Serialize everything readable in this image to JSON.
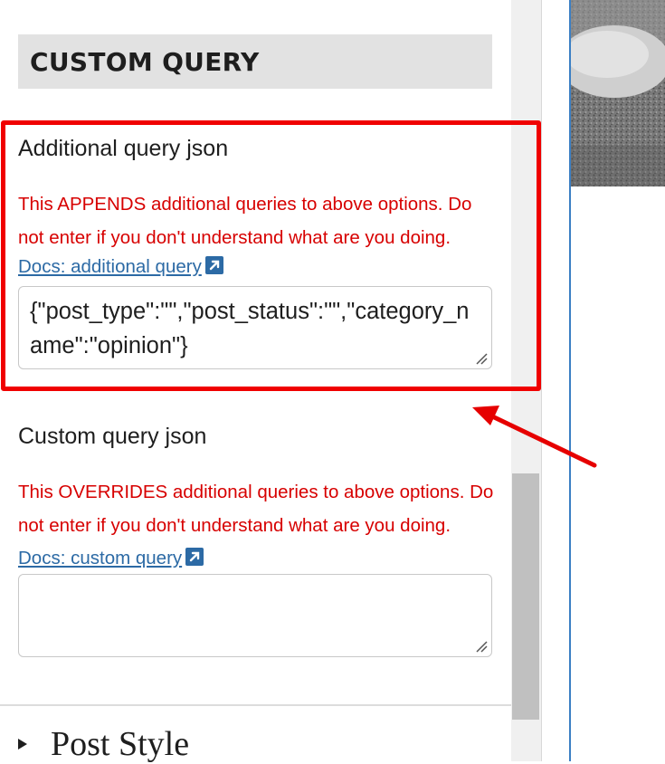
{
  "section": {
    "title": "CUSTOM QUERY"
  },
  "additional_query": {
    "label": "Additional query json",
    "warning": "This APPENDS additional queries to above options. Do not enter if you don't understand what are you doing.",
    "docs_link": "Docs: additional query",
    "value": "{\"post_type\":\"\",\"post_status\":\"\",\"category_name\":\"opinion\"}"
  },
  "custom_query": {
    "label": "Custom query json",
    "warning": "This OVERRIDES additional queries to above options. Do not enter if you don't understand what are you doing.",
    "docs_link": "Docs: custom query",
    "value": ""
  },
  "post_style": {
    "label": "Post Style"
  },
  "colors": {
    "warning_red": "#d70000",
    "link_blue": "#2c6aa5",
    "annotation_red": "#f00000",
    "header_bg": "#e2e2e2"
  },
  "icons": {
    "external_link": "external-link-icon",
    "collapse": "triangle-right-icon",
    "resize": "resize-grip-icon"
  }
}
